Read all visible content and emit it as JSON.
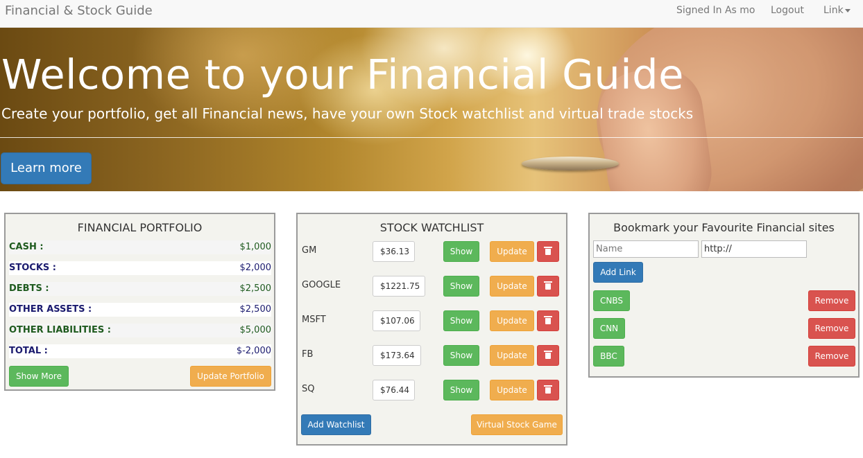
{
  "navbar": {
    "brand": "Financial & Stock Guide",
    "signed_in": "Signed In As mo",
    "logout": "Logout",
    "link": "Link"
  },
  "hero": {
    "title": "Welcome to your Financial Guide",
    "subtitle": "Create your portfolio, get all Financial news, have your own Stock watchlist and virtual trade stocks",
    "button": "Learn more"
  },
  "portfolio": {
    "title": "FINANCIAL PORTFOLIO",
    "rows": [
      {
        "label": "CASH :",
        "value": "$1,000"
      },
      {
        "label": "STOCKS :",
        "value": "$2,000"
      },
      {
        "label": "DEBTS :",
        "value": "$2,500"
      },
      {
        "label": "OTHER ASSETS :",
        "value": "$2,500"
      },
      {
        "label": "OTHER LIABILITIES :",
        "value": "$5,000"
      },
      {
        "label": "TOTAL :",
        "value": "$-2,000"
      }
    ],
    "show_more": "Show More",
    "update": "Update Portfolio"
  },
  "watchlist": {
    "title": "STOCK WATCHLIST",
    "items": [
      {
        "symbol": "GM",
        "price": "$36.13"
      },
      {
        "symbol": "GOOGLE",
        "price": "$1221.75"
      },
      {
        "symbol": "MSFT",
        "price": "$107.06"
      },
      {
        "symbol": "FB",
        "price": "$173.64"
      },
      {
        "symbol": "SQ",
        "price": "$76.44"
      }
    ],
    "show_label": "Show",
    "update_label": "Update",
    "add": "Add Watchlist",
    "game": "Virtual Stock Game"
  },
  "bookmarks": {
    "title": "Bookmark your Favourite Financial sites",
    "name_placeholder": "Name",
    "url_value": "http://",
    "add": "Add Link",
    "items": [
      {
        "label": "CNBS"
      },
      {
        "label": "CNN"
      },
      {
        "label": "BBC"
      }
    ],
    "remove_label": "Remove"
  },
  "colors": {
    "primary": "#337ab7",
    "success": "#5cb85c",
    "warning": "#f0ad4e",
    "danger": "#d9534f",
    "label_green": "#1e5a1e",
    "label_navy": "#1a1a6e"
  }
}
